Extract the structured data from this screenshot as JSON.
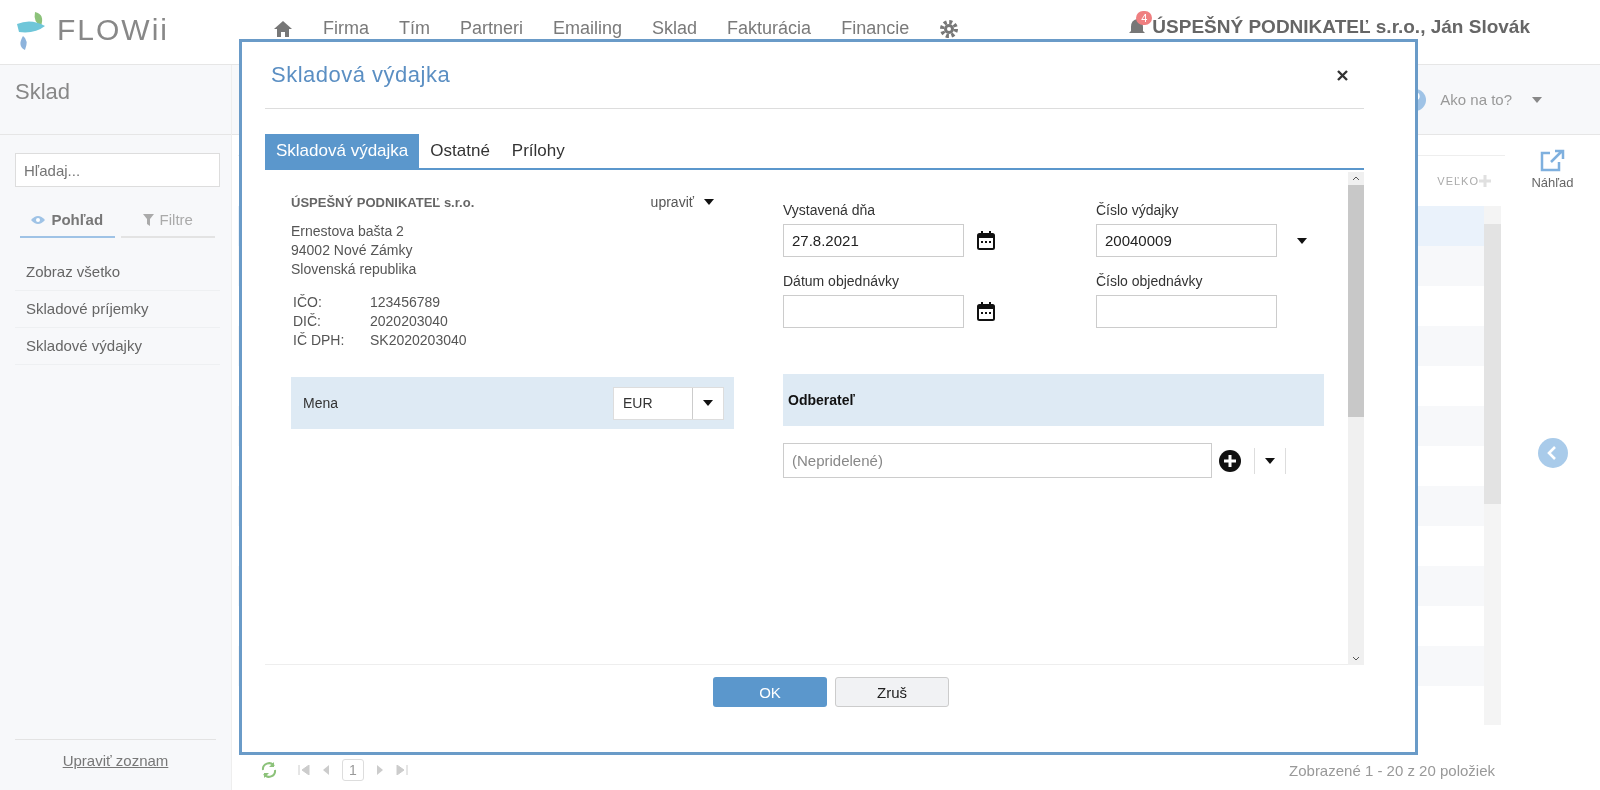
{
  "app": {
    "logo": "FLOWii",
    "nav": [
      {
        "label": "Firma"
      },
      {
        "label": "Tím"
      },
      {
        "label": "Partneri"
      },
      {
        "label": "Emailing"
      },
      {
        "label": "Sklad"
      },
      {
        "label": "Fakturácia"
      },
      {
        "label": "Financie"
      }
    ],
    "notifications": "4",
    "account": "ÚSPEŠNÝ PODNIKATEĽ s.r.o., Ján Slovák"
  },
  "sidebar": {
    "title": "Sklad",
    "search": {
      "placeholder": "Hľadaj..."
    },
    "tabs": [
      {
        "label": "Pohľad",
        "selected": true
      },
      {
        "label": "Filtre",
        "selected": false
      }
    ],
    "items": [
      "Zobraz všetko",
      "Skladové príjemky",
      "Skladové výdajky"
    ],
    "footer_link": "Upraviť zoznam"
  },
  "toolbar": {
    "help": "Ako na to?",
    "preview": "Náhľad",
    "column_header": "VEĽKO"
  },
  "table": {
    "rows": [
      {
        "selected": true
      },
      {
        "selected": false
      },
      {
        "selected": false
      },
      {
        "selected": false
      },
      {
        "selected": false
      },
      {
        "selected": false
      },
      {
        "selected": false
      },
      {
        "selected": false
      },
      {
        "selected": false
      },
      {
        "selected": false
      },
      {
        "selected": false
      },
      {
        "selected": false
      }
    ]
  },
  "pager": {
    "page": "1",
    "summary": "Zobrazené 1 - 20 z 20 položiek"
  },
  "dialog": {
    "title": "Skladová výdajka",
    "tabs": [
      {
        "label": "Skladová výdajka",
        "selected": true
      },
      {
        "label": "Ostatné",
        "selected": false
      },
      {
        "label": "Prílohy",
        "selected": false
      }
    ],
    "company": {
      "name": "ÚSPEŠNÝ PODNIKATEĽ s.r.o.",
      "edit": "upraviť",
      "address": [
        "Ernestova bašta 2",
        "94002 Nové Zámky",
        "Slovenská republika"
      ],
      "ids": [
        {
          "label": "IČO:",
          "value": "123456789"
        },
        {
          "label": "DIČ:",
          "value": "2020203040"
        },
        {
          "label": "IČ DPH:",
          "value": "SK2020203040"
        }
      ]
    },
    "currency": {
      "label": "Mena",
      "value": "EUR"
    },
    "fields": [
      {
        "label": "Vystavená dňa",
        "value": "27.8.2021",
        "kind": "date"
      },
      {
        "label": "Číslo výdajky",
        "value": "20040009",
        "kind": "dropdown"
      },
      {
        "label": "Dátum objednávky",
        "kind": "date"
      },
      {
        "label": "Číslo objednávky",
        "kind": "text"
      }
    ],
    "customer": {
      "label": "Odberateľ",
      "placeholder": "(Nepridelené)"
    },
    "buttons": [
      {
        "label": "OK",
        "kind": "primary"
      },
      {
        "label": "Zruš",
        "kind": "secondary"
      }
    ]
  }
}
